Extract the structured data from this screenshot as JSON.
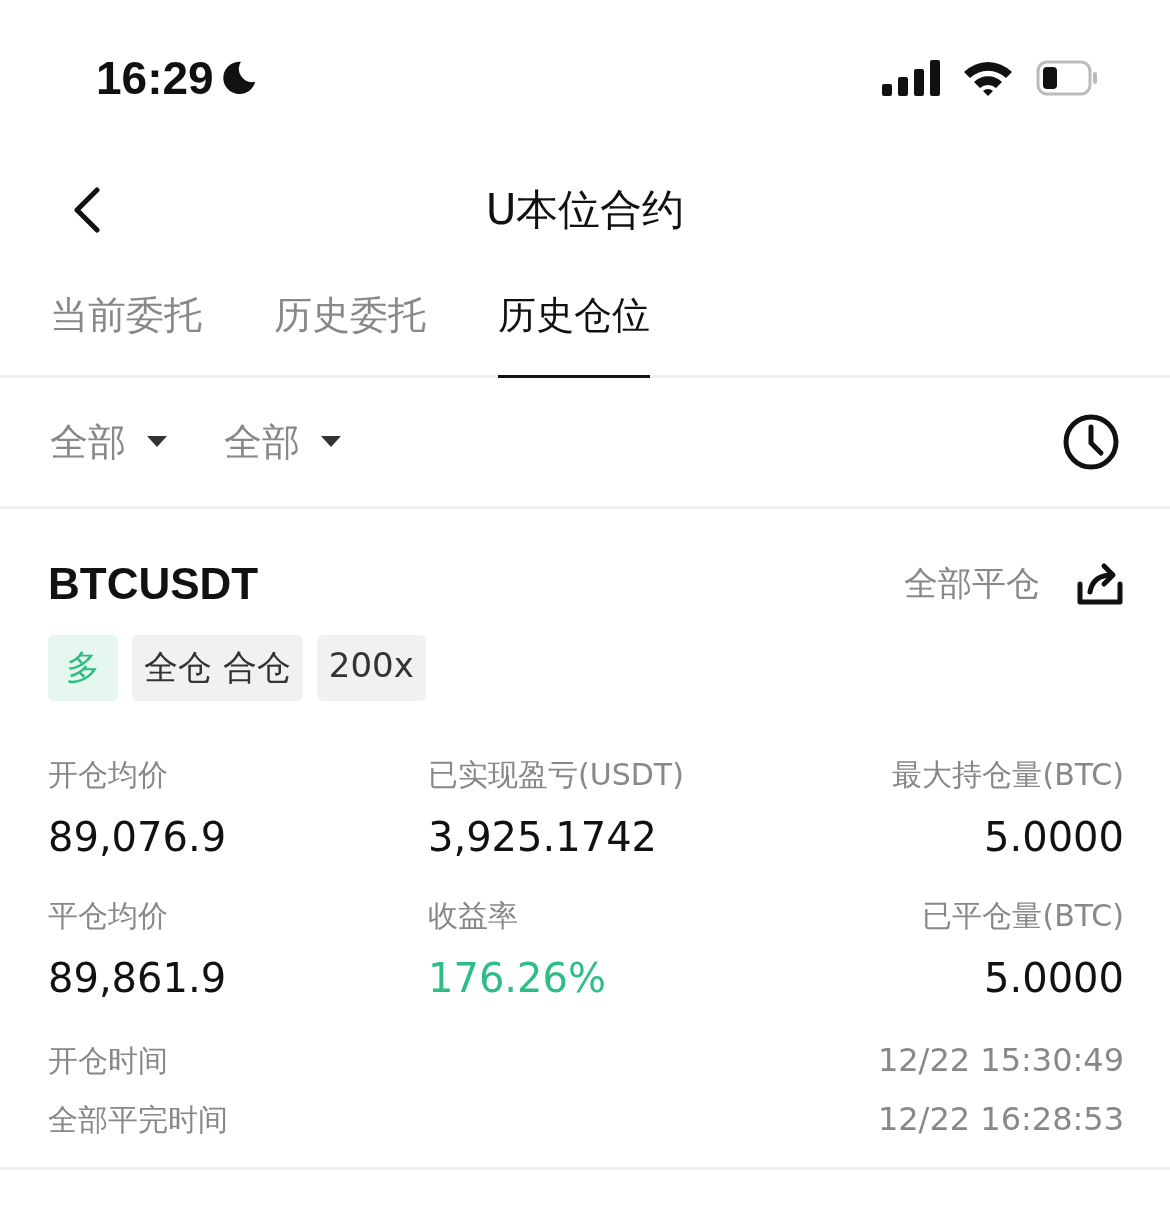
{
  "status_bar": {
    "time": "16:29"
  },
  "header": {
    "title": "U本位合约"
  },
  "tabs": [
    {
      "label": "当前委托",
      "selected": false
    },
    {
      "label": "历史委托",
      "selected": false
    },
    {
      "label": "历史仓位",
      "selected": true
    }
  ],
  "filters": [
    {
      "label": "全部"
    },
    {
      "label": "全部"
    }
  ],
  "position": {
    "symbol": "BTCUSDT",
    "close_all": "全部平仓",
    "tags": [
      {
        "label": "多",
        "kind": "long"
      },
      {
        "label": "全仓 合仓",
        "kind": "plain"
      },
      {
        "label": "200x",
        "kind": "plain"
      }
    ],
    "stats": [
      {
        "label": "开仓均价",
        "value": "89,076.9",
        "kind": "normal"
      },
      {
        "label": "已实现盈亏(USDT)",
        "value": "3,925.1742",
        "kind": "normal"
      },
      {
        "label": "最大持仓量(BTC)",
        "value": "5.0000",
        "kind": "normal"
      },
      {
        "label": "平仓均价",
        "value": "89,861.9",
        "kind": "normal"
      },
      {
        "label": "收益率",
        "value": "176.26%",
        "kind": "gain"
      },
      {
        "label": "已平仓量(BTC)",
        "value": "5.0000",
        "kind": "normal"
      }
    ],
    "times": [
      {
        "label": "开仓时间",
        "value": "12/22 15:30:49"
      },
      {
        "label": "全部平完时间",
        "value": "12/22 16:28:53"
      }
    ]
  }
}
